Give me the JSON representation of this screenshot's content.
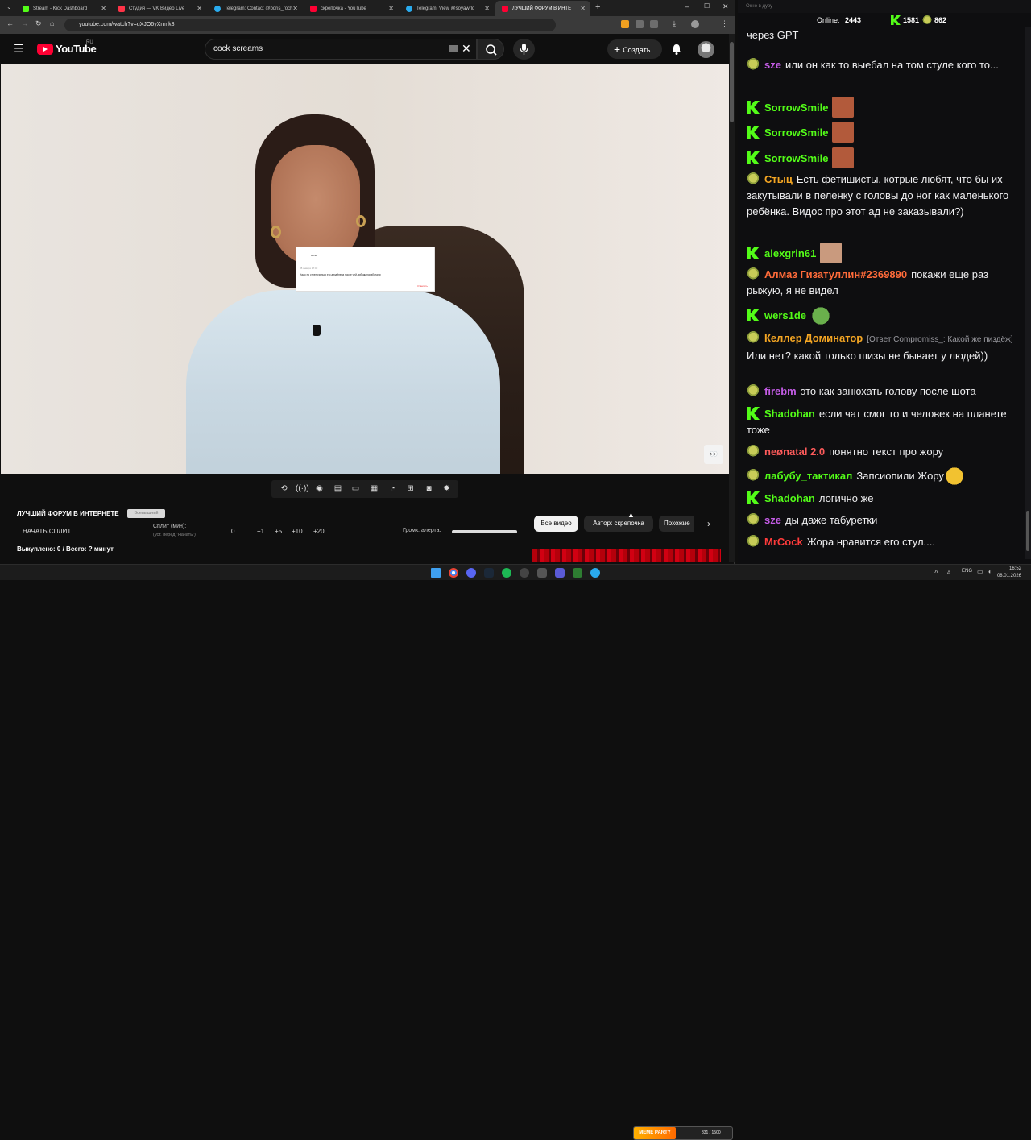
{
  "browser": {
    "tabs": [
      {
        "label": "Stream - Kick Dashboard",
        "color": "#53fc18"
      },
      {
        "label": "Студия — VK Видео Live",
        "color": "#ff3347"
      },
      {
        "label": "Telegram: Contact @boris_roch",
        "color": "#2aabee"
      },
      {
        "label": "скрепочка - YouTube",
        "color": "#ff0033"
      },
      {
        "label": "Telegram: View @soyawrld",
        "color": "#2aabee"
      },
      {
        "label": "ЛУЧШИЙ ФОРУМ В ИНТЕ",
        "color": "#ff0033"
      }
    ],
    "url": "youtube.com/watch?v=uXJO6yXnmk8"
  },
  "youtube": {
    "logo_text": "YouTube",
    "region": "RU",
    "search_query": "cock screams",
    "create_label": "Создать"
  },
  "video": {
    "card_line1": "Нели",
    "card_line2": "28 января 17:02",
    "card_line3": "Надо по стрепочиться это дизайнера после чей-нибудь поработали",
    "card_reply": "Ответить"
  },
  "bottom": {
    "forum_title": "ЛУЧШИЙ ФОРУМ В ИНТЕРНЕТЕ",
    "forum_badge": "Всевышний",
    "start_split": "НАЧАТЬ СПЛИТ",
    "split_label": "Сплит (мин):",
    "split_hint": "(уст. перед \"Начать\")",
    "split_value": "0",
    "step_buttons": [
      "+1",
      "+5",
      "+10",
      "+20"
    ],
    "alert_label": "Громк. алерта:",
    "bought": "Выкуплено: 0 / Всего: ? минут",
    "chips": [
      "Все видео",
      "Автор: скрепочка",
      "Похожие"
    ]
  },
  "chat": {
    "window_title": "Окно в дуру",
    "online_label": "Online:",
    "online_count": "2443",
    "kick_count": "1581",
    "other_count": "862",
    "messages": [
      {
        "badge": "pepe",
        "user": "",
        "user_color": "#d9b0ff",
        "text": "через GPT"
      },
      {
        "badge": "pepe",
        "user": "sze",
        "user_color": "#c35ce5",
        "text": "или он как то выебал на том стуле кого то..."
      },
      {
        "badge": "kick",
        "user": "SorrowSmile",
        "user_color": "#53fc18",
        "text": ""
      },
      {
        "badge": "kick",
        "user": "SorrowSmile",
        "user_color": "#53fc18",
        "text": ""
      },
      {
        "badge": "kick",
        "user": "SorrowSmile",
        "user_color": "#53fc18",
        "text": ""
      },
      {
        "badge": "pepe",
        "user": "Стыц",
        "user_color": "#f5a623",
        "text": "Есть фетишисты, котрые любят, что бы их закутывали в пеленку с головы до ног как маленького ребёнка. Видос про этот ад не заказывали?)"
      },
      {
        "badge": "kick",
        "user": "alexgrin61",
        "user_color": "#53fc18",
        "text": ""
      },
      {
        "badge": "pepe",
        "user": "Алмаз Гизатуллин#2369890",
        "user_color": "#ff6b3a",
        "text": "покажи еще раз рыжую, я не видел"
      },
      {
        "badge": "kick",
        "user": "wers1de",
        "user_color": "#53fc18",
        "text": ""
      },
      {
        "badge": "pepe",
        "user": "Келлер Доминатор",
        "user_color": "#f5a623",
        "reply": "[Ответ Compromiss_: Какой же пиздёж]",
        "text": "Или нет? какой только шизы не бывает у людей))"
      },
      {
        "badge": "pepe",
        "user": "firebm",
        "user_color": "#c35ce5",
        "text": "это как занюхать голову после шота"
      },
      {
        "badge": "kick",
        "user": "Shadohan",
        "user_color": "#53fc18",
        "text": "если чат смог то и человек на планете тоже"
      },
      {
        "badge": "pepe",
        "user": "neønatal 2.0",
        "user_color": "#ff5b5b",
        "text": "понятно текст про жору"
      },
      {
        "badge": "pepe",
        "user": "лабубу_тактикал",
        "user_color": "#53fc18",
        "text": "Запсиопили Жору"
      },
      {
        "badge": "kick",
        "user": "Shadohan",
        "user_color": "#53fc18",
        "text": "логично же"
      },
      {
        "badge": "pepe",
        "user": "sze",
        "user_color": "#c35ce5",
        "text": "ды даже табуретки"
      },
      {
        "badge": "pepe",
        "user": "MrCock",
        "user_color": "#ff3b3b",
        "text": "Жора нравится его стул...."
      }
    ]
  },
  "taskbar": {
    "lang": "ENG",
    "time": "16:52",
    "date": "08.01.2026",
    "meme_label": "MEME PARTY",
    "meme_progress": "831 / 1500"
  }
}
